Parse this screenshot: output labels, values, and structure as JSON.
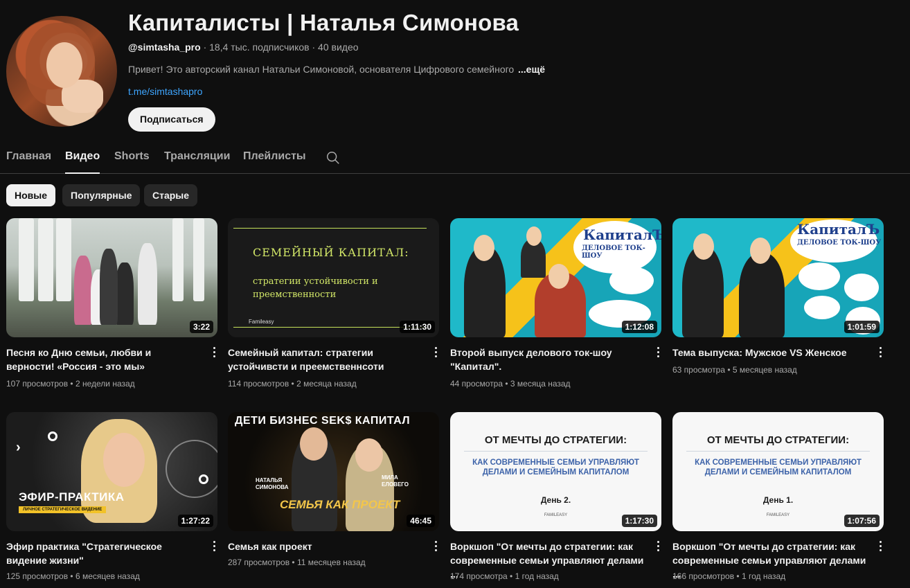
{
  "channel": {
    "name": "Капиталисты | Наталья Симонова",
    "handle": "@simtasha_pro",
    "stats": " · 18,4 тыс. подписчиков · 40 видео",
    "description": "Привет! Это авторский канал Натальи Симоновой, основателя Цифрового семейного",
    "more": "...ещё",
    "link": "t.me/simtashapro",
    "subscribe_label": "Подписаться"
  },
  "tabs": [
    "Главная",
    "Видео",
    "Shorts",
    "Трансляции",
    "Плейлисты"
  ],
  "active_tab": "Видео",
  "chips": [
    "Новые",
    "Популярные",
    "Старые"
  ],
  "active_chip": "Новые",
  "videos": [
    {
      "title": "Песня ко Дню семьи, любви и верности! «Россия - это мы»",
      "views": "107 просмотров",
      "age": "2 недели назад",
      "duration": "3:22"
    },
    {
      "title": "Семейный капитал: стратегии устойчивсти и преемственнсоти",
      "views": "114 просмотров",
      "age": "2 месяца назад",
      "duration": "1:11:30",
      "thumb_heading": "СЕМЕЙНЫЙ КАПИТАЛ:",
      "thumb_sub": "стратегии устойчивости и преемственности",
      "thumb_brand": "Famileasy"
    },
    {
      "title": "Второй выпуск делового ток-шоу \"Капитал\".",
      "views": "44 просмотра",
      "age": "3 месяца назад",
      "duration": "1:12:08",
      "thumb_logo": "КапиталЪ",
      "thumb_logo_sub": "ДЕЛОВОЕ ТОК-ШОУ"
    },
    {
      "title": "Тема выпуска: Мужское VS Женское",
      "views": "63 просмотра",
      "age": "5 месяцев назад",
      "duration": "1:01:59",
      "thumb_logo": "КапиталЪ",
      "thumb_logo_sub": "ДЕЛОВОЕ ТОК-ШОУ"
    },
    {
      "title": "Эфир практика \"Стратегическое видение жизни\"",
      "views": "125 просмотров",
      "age": "6 месяцев назад",
      "duration": "1:27:22",
      "thumb_label": "ЭФИР-ПРАКТИКА",
      "thumb_sub": "ЛИЧНОЕ СТРАТЕГИЧЕСКОЕ ВИДЕНИЕ"
    },
    {
      "title": "Семья как проект",
      "views": "287 просмотров",
      "age": "11 месяцев назад",
      "duration": "46:45",
      "thumb_top": "ДЕТИ БИЗНЕС SEK$ КАПИТАЛ",
      "thumb_caption": "СЕМЬЯ КАК ПРОЕКТ",
      "thumb_name1": "НАТАЛЬЯ СИМОНОВА",
      "thumb_name2": "МИЛА ЕЛОВЕГО"
    },
    {
      "title": "Воркшоп \"От мечты до стратегии: как современные семьи управляют делами ...",
      "views": "174 просмотра",
      "age": "1 год назад",
      "duration": "1:17:30",
      "thumb_heading": "ОТ МЕЧТЫ ДО СТРАТЕГИИ:",
      "thumb_sub": "КАК СОВРЕМЕННЫЕ СЕМЬИ УПРАВЛЯЮТ ДЕЛАМИ И СЕМЕЙНЫМ КАПИТАЛОМ",
      "thumb_day": "День 2.",
      "thumb_brand": "FAMILEASY"
    },
    {
      "title": "Воркшоп \"От мечты до стратегии: как современные семьи управляют делами ...",
      "views": "166 просмотров",
      "age": "1 год назад",
      "duration": "1:07:56",
      "thumb_heading": "ОТ МЕЧТЫ ДО СТРАТЕГИИ:",
      "thumb_sub": "КАК СОВРЕМЕННЫЕ СЕМЬИ УПРАВЛЯЮТ ДЕЛАМИ И СЕМЕЙНЫМ КАПИТАЛОМ",
      "thumb_day": "День 1.",
      "thumb_brand": "FAMILEASY"
    }
  ]
}
